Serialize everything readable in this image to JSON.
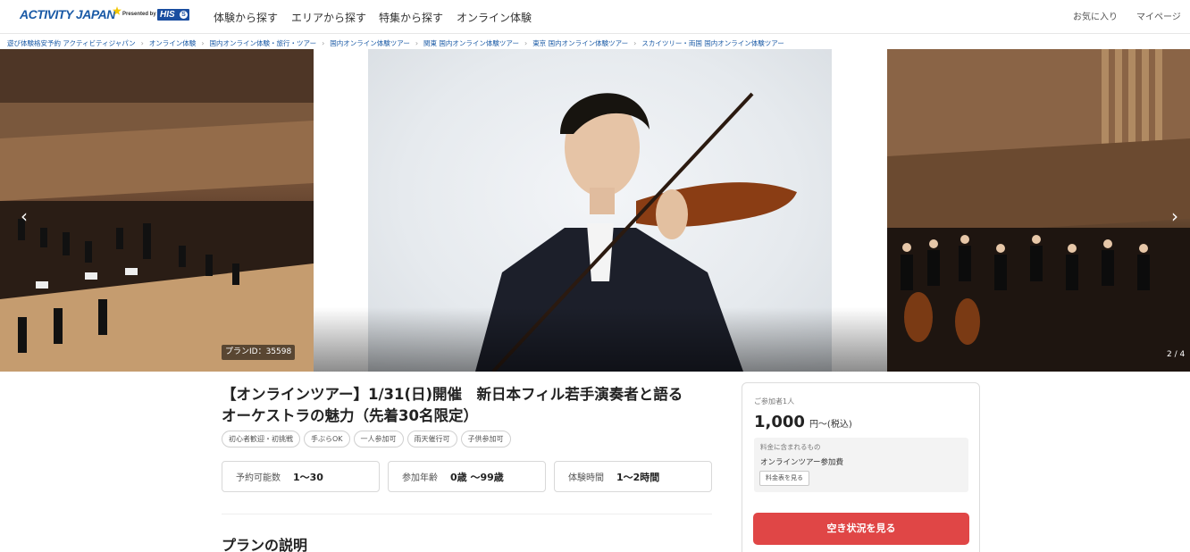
{
  "header": {
    "logo_text": "ACTIVITY JAPAN",
    "logo_presented": "Presented by",
    "logo_his": "HIS",
    "nav": [
      "体験から探す",
      "エリアから探す",
      "特集から探す",
      "オンライン体験"
    ],
    "favorites": "お気に入り",
    "mypage": "マイページ"
  },
  "breadcrumb": [
    "遊び体験格安予約 アクティビティジャパン",
    "オンライン体験",
    "国内オンライン体験・旅行・ツアー",
    "国内オンライン体験ツアー",
    "関東 国内オンライン体験ツアー",
    "東京 国内オンライン体験ツアー",
    "スカイツリー・両国 国内オンライン体験ツアー"
  ],
  "gallery": {
    "plan_id": "プランID：35598",
    "counter": "2 / 4",
    "prev_icon": "‹",
    "next_icon": "›"
  },
  "plan": {
    "title_line1": "【オンラインツアー】1/31(日)開催　新日本フィル若手演奏者と語る",
    "title_line2": "オーケストラの魅力（先着30名限定）",
    "tags": [
      "初心者歓迎・初挑戦",
      "手ぶらOK",
      "一人参加可",
      "雨天催行可",
      "子供参加可"
    ],
    "stats": [
      {
        "label": "予約可能数",
        "value": "1〜30"
      },
      {
        "label": "参加年齢",
        "value": "0歳 〜99歳"
      },
      {
        "label": "体験時間",
        "value": "1〜2時間"
      }
    ],
    "section_title": "プランの説明"
  },
  "booking": {
    "participants": "ご参加者1人",
    "price": "1,000",
    "price_suffix": "円〜(税込)",
    "included_label": "料金に含まれるもの",
    "included_item": "オンラインツアー参加費",
    "price_table_button": "料金表を見る",
    "cta": "空き状況を見る"
  },
  "colors": {
    "brand_blue": "#1a5aa6",
    "cta_red": "#e04646"
  }
}
